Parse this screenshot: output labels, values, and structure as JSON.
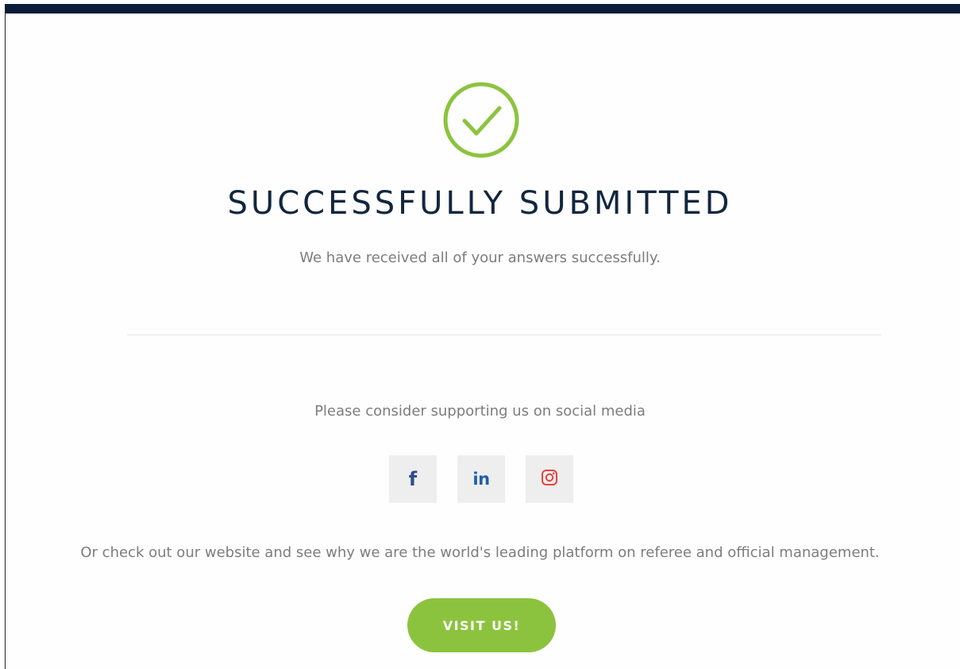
{
  "colors": {
    "top_bar": "#0b1c3a",
    "left_border": "#222222",
    "check_green": "#8cc33e",
    "title": "#12263f",
    "body_text": "#7d7d7d",
    "button_green": "#8cc33e",
    "facebook_blue": "#2e4d8c",
    "linkedin_blue": "#1e5fa8",
    "instagram_red": "#e8433f"
  },
  "success": {
    "icon": "check-circle-icon",
    "title": "SUCCESSFULLY SUBMITTED",
    "subtitle": "We have received all of your answers successfully."
  },
  "social": {
    "prompt": "Please consider supporting us on social media",
    "links": [
      {
        "name": "facebook",
        "icon": "facebook-icon",
        "glyph": "f"
      },
      {
        "name": "linkedin",
        "icon": "linkedin-icon",
        "glyph": "in"
      },
      {
        "name": "instagram",
        "icon": "instagram-icon",
        "glyph": ""
      }
    ]
  },
  "website": {
    "text": "Or check out our website and see why we are the world's leading platform on referee and official management.",
    "button_label": "VISIT US!"
  }
}
